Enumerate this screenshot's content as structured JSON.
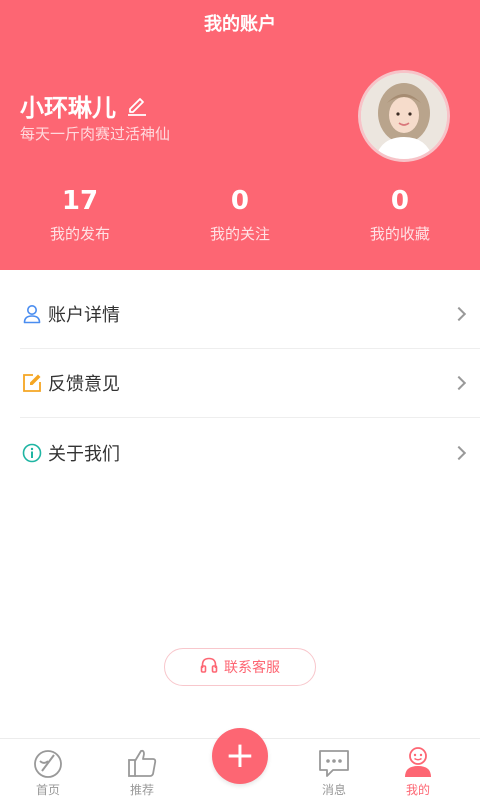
{
  "header": {
    "title": "我的账户"
  },
  "profile": {
    "name": "小环琳儿",
    "bio": "每天一斤肉赛过活神仙"
  },
  "stats": [
    {
      "value": "17",
      "label": "我的发布"
    },
    {
      "value": "0",
      "label": "我的关注"
    },
    {
      "value": "0",
      "label": "我的收藏"
    }
  ],
  "menu": [
    {
      "label": "账户详情",
      "icon": "user-icon",
      "color": "#4a8df0"
    },
    {
      "label": "反馈意见",
      "icon": "edit-icon",
      "color": "#f5a623"
    },
    {
      "label": "关于我们",
      "icon": "info-icon",
      "color": "#1fb5a3"
    }
  ],
  "contact": {
    "label": "联系客服",
    "icon": "headphone-icon"
  },
  "tabbar": {
    "items": [
      {
        "label": "首页",
        "icon": "home-icon"
      },
      {
        "label": "推荐",
        "icon": "thumbs-up-icon"
      },
      {
        "label": "",
        "icon": "plus-icon"
      },
      {
        "label": "消息",
        "icon": "message-icon"
      },
      {
        "label": "我的",
        "icon": "profile-icon"
      }
    ],
    "fab_symbol": "+",
    "active_color": "#fd6673"
  },
  "colors": {
    "brand": "#fd6673"
  }
}
